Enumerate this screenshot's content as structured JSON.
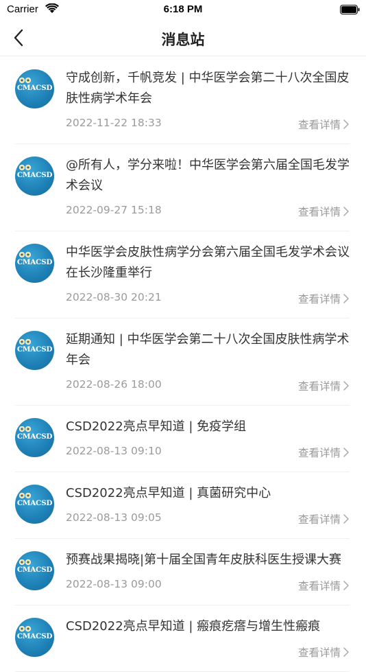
{
  "status_bar": {
    "carrier": "Carrier",
    "time": "6:18 PM"
  },
  "nav": {
    "title": "消息站"
  },
  "avatar_text": "CMACSD",
  "more_label": "查看详情",
  "items": [
    {
      "headline": "守成创新，千帆竞发 | 中华医学会第二十八次全国皮肤性病学术年会",
      "date": "2022-11-22 18:33"
    },
    {
      "headline": "@所有人，学分来啦！中华医学会第六届全国毛发学术会议",
      "date": "2022-09-27 15:18"
    },
    {
      "headline": "中华医学会皮肤性病学分会第六届全国毛发学术会议在长沙隆重举行",
      "date": "2022-08-30 20:21"
    },
    {
      "headline": "延期通知 | 中华医学会第二十八次全国皮肤性病学术年会",
      "date": "2022-08-26 18:00"
    },
    {
      "headline": "CSD2022亮点早知道 | 免疫学组",
      "date": "2022-08-13 09:10"
    },
    {
      "headline": "CSD2022亮点早知道 | 真菌研究中心",
      "date": "2022-08-13 09:05"
    },
    {
      "headline": "预赛战果揭晓|第十届全国青年皮肤科医生授课大赛",
      "date": "2022-08-13 09:00"
    },
    {
      "headline": "CSD2022亮点早知道 | 瘢痕疙瘩与增生性瘢痕",
      "date": ""
    }
  ]
}
